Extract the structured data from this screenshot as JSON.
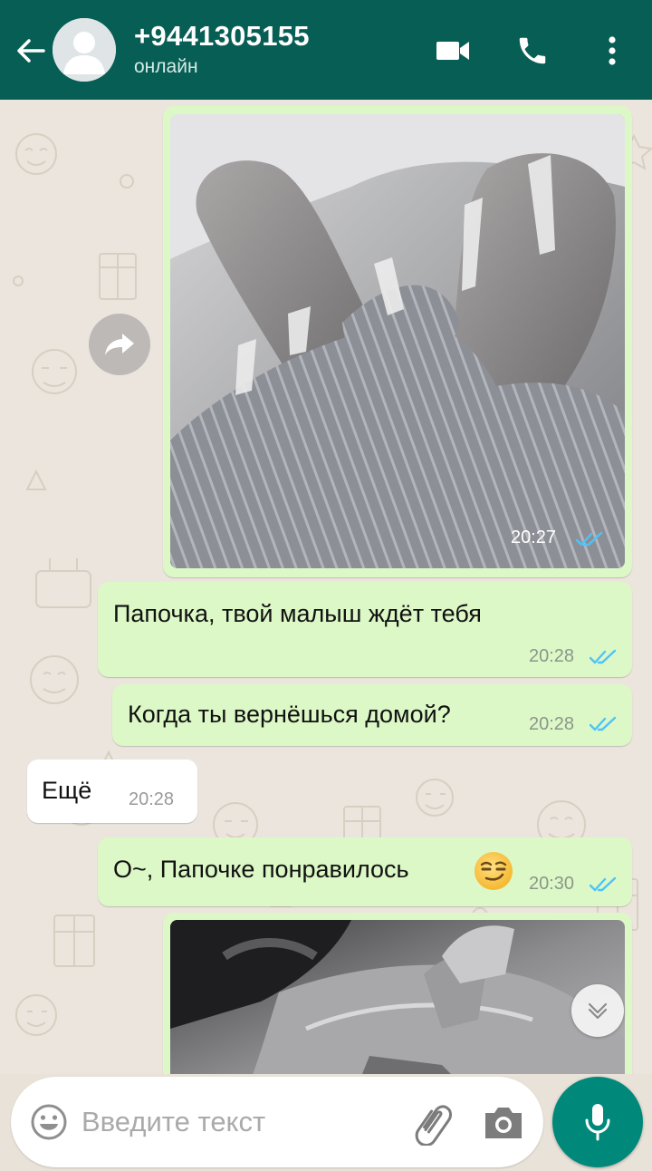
{
  "header": {
    "contact_name": "+9441305155",
    "status": "онлайн",
    "icons": [
      "back-arrow-icon",
      "avatar-placeholder-icon",
      "video-call-icon",
      "voice-call-icon",
      "more-options-icon"
    ],
    "background_color": "#075e54"
  },
  "messages": [
    {
      "type": "image",
      "direction": "outgoing",
      "time": "20:27",
      "status": "read"
    },
    {
      "type": "text",
      "direction": "outgoing",
      "text": "Папочка, твой малыш ждёт тебя",
      "time": "20:28",
      "status": "read"
    },
    {
      "type": "text",
      "direction": "outgoing",
      "text": "Когда ты вернёшься домой?",
      "time": "20:28",
      "status": "read"
    },
    {
      "type": "text",
      "direction": "incoming",
      "text": "Ещё",
      "time": "20:28"
    },
    {
      "type": "text",
      "direction": "outgoing",
      "text": "О~, Папочке понравилось",
      "emoji": "smirking-face",
      "time": "20:30",
      "status": "read"
    },
    {
      "type": "image",
      "direction": "outgoing",
      "partial": true
    }
  ],
  "composer": {
    "placeholder": "Введите текст",
    "icons": [
      "emoji-icon",
      "attach-icon",
      "camera-icon",
      "mic-icon"
    ]
  },
  "colors": {
    "outgoing_bubble": "#dcf8c6",
    "incoming_bubble": "#ffffff",
    "read_ticks": "#4fc3f7",
    "mic_button": "#00897b"
  }
}
